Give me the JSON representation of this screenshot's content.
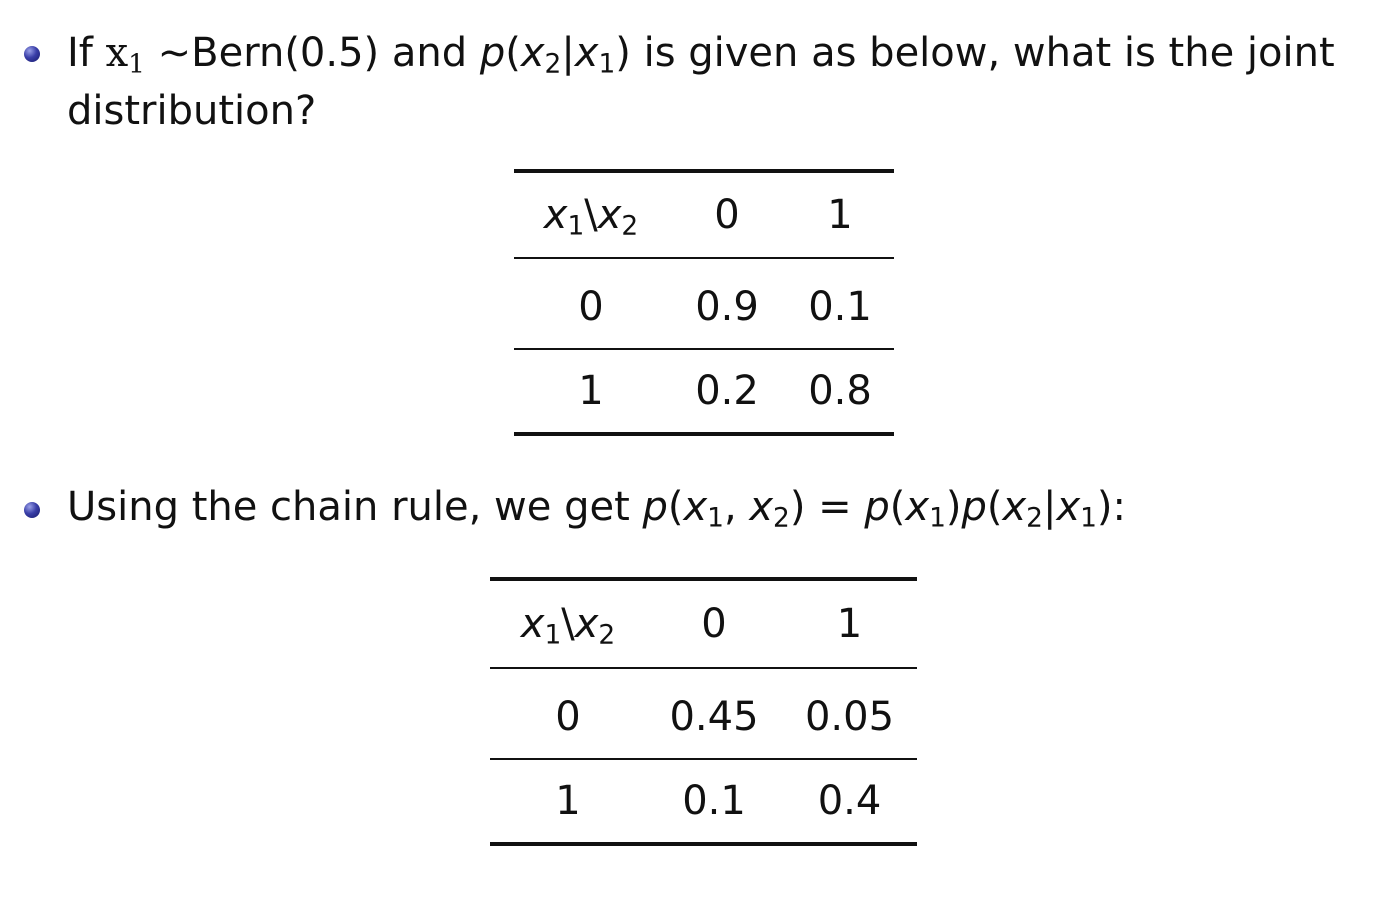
{
  "item1": {
    "text_if": "If ",
    "x1": "x",
    "x1_sub": "1",
    "tilde_bern": " ∼Bern(0.5) and ",
    "p": "p",
    "paren_open": "(",
    "x2": "x",
    "x2_sub": "2",
    "bar": "|",
    "x1b": "x",
    "x1b_sub": "1",
    "paren_close": ")",
    "tail": " is given as below, what is the joint distribution?"
  },
  "table1": {
    "header_x1": "x",
    "header_x1_sub": "1",
    "header_sep": "\\",
    "header_x2": "x",
    "header_x2_sub": "2",
    "col_labels": [
      "0",
      "1"
    ],
    "rows": [
      {
        "label": "0",
        "values": [
          "0.9",
          "0.1"
        ]
      },
      {
        "label": "1",
        "values": [
          "0.2",
          "0.8"
        ]
      }
    ]
  },
  "item2": {
    "text": "Using the chain rule, we get ",
    "formula_p1": "p",
    "formula_open1": "(",
    "formula_x1": "x",
    "formula_x1_sub": "1",
    "formula_comma": ", ",
    "formula_x2": "x",
    "formula_x2_sub": "2",
    "formula_close1": ")",
    "formula_eq": " = ",
    "formula_p2": "p",
    "formula_open2": "(",
    "formula_x1c": "x",
    "formula_x1c_sub": "1",
    "formula_close2": ")",
    "formula_p3": "p",
    "formula_open3": "(",
    "formula_x2d": "x",
    "formula_x2d_sub": "2",
    "formula_bar": "|",
    "formula_x1d": "x",
    "formula_x1d_sub": "1",
    "formula_close3": ")",
    "colon": ":"
  },
  "table2": {
    "header_x1": "x",
    "header_x1_sub": "1",
    "header_sep": "\\",
    "header_x2": "x",
    "header_x2_sub": "2",
    "col_labels": [
      "0",
      "1"
    ],
    "rows": [
      {
        "label": "0",
        "values": [
          "0.45",
          "0.05"
        ]
      },
      {
        "label": "1",
        "values": [
          "0.1",
          "0.4"
        ]
      }
    ]
  }
}
